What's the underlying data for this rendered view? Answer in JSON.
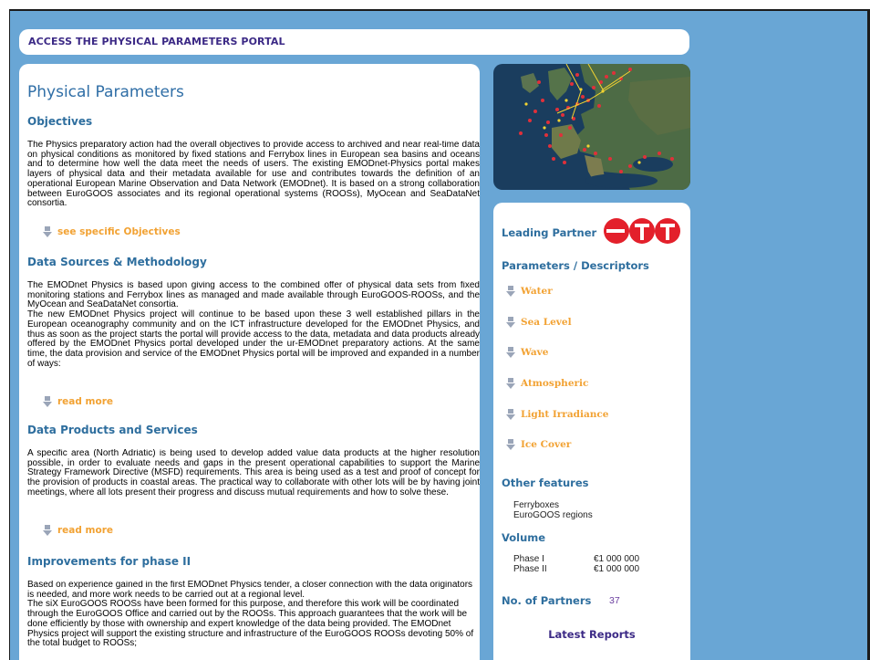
{
  "top_bar": {
    "title": "ACCESS THE PHYSICAL PARAMETERS PORTAL"
  },
  "main": {
    "title": "Physical Parameters",
    "sections": [
      {
        "heading": "Objectives",
        "text": "The Physics preparatory action had the overall objectives to provide access to archived and near real-time data on physical conditions as monitored by fixed stations and Ferrybox lines in European sea basins and oceans and to determine how well the data meet the needs of users. The existing EMODnet-Physics portal makes layers of physical data and their metadata available for use and contributes towards the definition of an operational European Marine Observation and Data Network (EMODnet). It is based on a strong collaboration between EuroGOOS associates and its regional operational systems (ROOSs), MyOcean and SeaDataNet consortia.",
        "link": "see specific Objectives"
      },
      {
        "heading": "Data Sources & Methodology",
        "text": "The EMODnet Physics is based upon giving access to the combined offer of physical data sets from fixed monitoring stations and Ferrybox lines as managed and made available through EuroGOOS-ROOSs, and the MyOcean and SeaDataNet consortia.\nThe new EMODnet Physics project will continue to be based upon these 3 well established pillars in the European oceanography community and on the ICT infrastructure developed for the EMODnet Physics, and thus as soon as the project starts the portal will provide access to the data, metadata and data products already offered by the EMODnet Physics portal developed under the ur-EMODnet preparatory actions. At the same time, the data provision and service of the EMODnet Physics portal will be improved and expanded in a number of ways:",
        "link": "read more"
      },
      {
        "heading": "Data Products and Services",
        "text": "A specific area (North Adriatic) is being used to develop added value data products at the higher resolution possible, in order to evaluate needs and gaps in the present operational capabilities to support the Marine Strategy Framework Directive (MSFD) requirements. This area is being used as a test and proof of concept for the provision of products in coastal areas. The practical way to collaborate with other lots will be by having joint meetings, where all lots present their progress and discuss mutual requirements and how to solve these.",
        "link": "read more"
      },
      {
        "heading": "Improvements for phase II",
        "text": "Based on experience gained in the first EMODnet Physics tender, a closer connection with the data originators is needed, and more work needs to be carried out at a regional level.\nThe siX EuroGOOS ROOSs have been formed for this purpose, and therefore this work will be coordinated through the EuroGOOS Office and carried out by the ROOSs. This approach guarantees that the work will be done efficiently by those with ownership and expert knowledge of the data being provided. The EMODnet Physics project will support the existing structure and infrastructure of the EuroGOOS ROOSs devoting 50% of the total budget to ROOSs;"
      }
    ]
  },
  "side": {
    "leading_partner_label": "Leading Partner",
    "logo_text": "ETT",
    "parameters_heading": "Parameters / Descriptors",
    "parameters": [
      "Water",
      "Sea Level",
      "Wave",
      "Atmospheric",
      "Light Irradiance",
      "Ice Cover"
    ],
    "other_features_heading": "Other features",
    "other_features": [
      "Ferryboxes",
      "EuroGOOS regions"
    ],
    "volume_heading": "Volume",
    "volume": [
      {
        "phase": "Phase I",
        "amount": "€1 000 000"
      },
      {
        "phase": "Phase II",
        "amount": "€1 000 000"
      }
    ],
    "partners_label": "No. of Partners",
    "partners_count": "37",
    "latest_reports": "Latest Reports"
  },
  "colors": {
    "background": "#69a6d5",
    "heading_blue": "#2e6e9e",
    "link_orange": "#f2a233",
    "title_purple": "#3c2a86",
    "logo_red": "#e3202b"
  },
  "icons": {
    "link_bullet": "down-arrow-icon",
    "map": "europe-map-image",
    "logo": "ett-logo"
  }
}
